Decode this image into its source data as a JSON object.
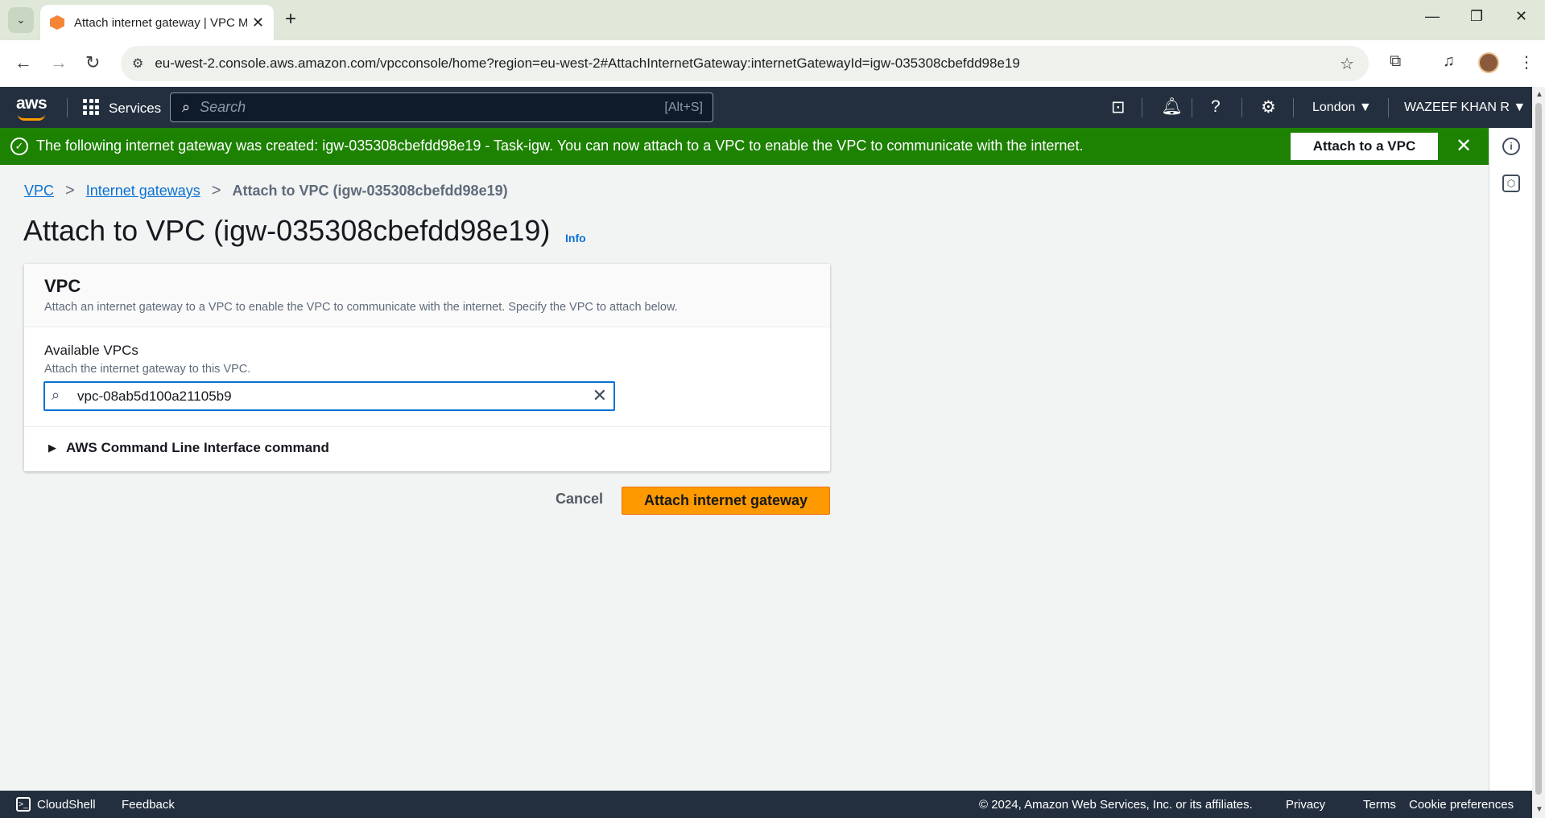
{
  "browser": {
    "tab_title": "Attach internet gateway | VPC M",
    "url": "eu-west-2.console.aws.amazon.com/vpcconsole/home?region=eu-west-2#AttachInternetGateway:internetGatewayId=igw-035308cbefdd98e19"
  },
  "aws_nav": {
    "logo": "aws",
    "services_label": "Services",
    "search_placeholder": "Search",
    "search_shortcut": "[Alt+S]",
    "region": "London ▼",
    "user": "WAZEEF KHAN R ▼"
  },
  "banner": {
    "message": "The following internet gateway was created: igw-035308cbefdd98e19 - Task-igw. You can now attach to a VPC to enable the VPC to communicate with the internet.",
    "action_label": "Attach to a VPC",
    "color": "#1d8102"
  },
  "breadcrumb": {
    "items": [
      "VPC",
      "Internet gateways"
    ],
    "current": "Attach to VPC (igw-035308cbefdd98e19)"
  },
  "page": {
    "title": "Attach to VPC (igw-035308cbefdd98e19)",
    "info_label": "Info"
  },
  "panel": {
    "title": "VPC",
    "description": "Attach an internet gateway to a VPC to enable the VPC to communicate with the internet. Specify the VPC to attach below.",
    "field_label": "Available VPCs",
    "field_description": "Attach the internet gateway to this VPC.",
    "vpc_value": "vpc-08ab5d100a21105b9",
    "cli_label": "AWS Command Line Interface command"
  },
  "actions": {
    "cancel_label": "Cancel",
    "attach_label": "Attach internet gateway",
    "primary_color": "#ff9900"
  },
  "footer": {
    "cloudshell": "CloudShell",
    "feedback": "Feedback",
    "copyright": "© 2024, Amazon Web Services, Inc. or its affiliates.",
    "privacy": "Privacy",
    "terms": "Terms",
    "cookies": "Cookie preferences"
  }
}
